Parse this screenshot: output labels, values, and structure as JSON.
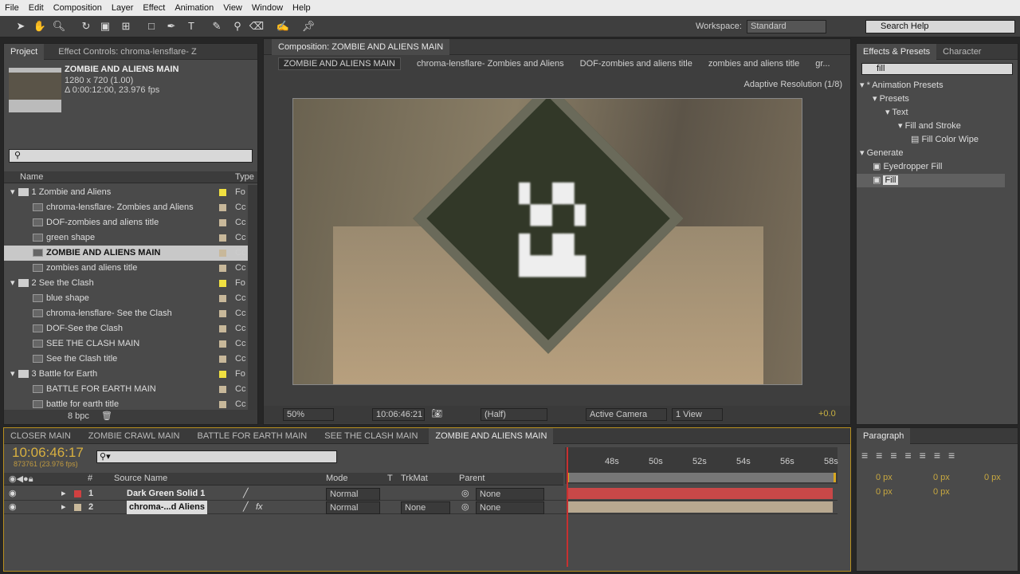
{
  "menu": [
    "File",
    "Edit",
    "Composition",
    "Layer",
    "Effect",
    "Animation",
    "View",
    "Window",
    "Help"
  ],
  "toolbar": {
    "workspace_label": "Workspace:",
    "workspace": "Standard",
    "search_placeholder": "Search Help"
  },
  "project": {
    "tab": "Project",
    "effect_controls_tab": "Effect Controls: chroma-lensflare- Z",
    "comp_name": "ZOMBIE AND ALIENS MAIN",
    "dims": "1280 x 720 (1.00)",
    "duration": "Δ 0:00:12:00, 23.976 fps",
    "col_name": "Name",
    "col_type": "Type",
    "bpc": "8 bpc",
    "items": [
      {
        "label": "1 Zombie and Aliens",
        "folder": true,
        "color": "#f0e040",
        "type": "Fo"
      },
      {
        "label": "chroma-lensflare- Zombies and Aliens",
        "color": "#c8b89a",
        "type": "Cc"
      },
      {
        "label": "DOF-zombies and aliens title",
        "color": "#c8b89a",
        "type": "Cc"
      },
      {
        "label": "green shape",
        "color": "#c8b89a",
        "type": "Cc"
      },
      {
        "label": "ZOMBIE AND ALIENS MAIN",
        "color": "#c8b89a",
        "type": "Cc",
        "selected": true
      },
      {
        "label": "zombies and aliens title",
        "color": "#c8b89a",
        "type": "Cc"
      },
      {
        "label": "2 See the Clash",
        "folder": true,
        "color": "#f0e040",
        "type": "Fo"
      },
      {
        "label": "blue shape",
        "color": "#c8b89a",
        "type": "Cc"
      },
      {
        "label": "chroma-lensflare- See the Clash",
        "color": "#c8b89a",
        "type": "Cc"
      },
      {
        "label": "DOF-See the Clash",
        "color": "#c8b89a",
        "type": "Cc"
      },
      {
        "label": "SEE THE CLASH MAIN",
        "color": "#c8b89a",
        "type": "Cc"
      },
      {
        "label": "See the Clash title",
        "color": "#c8b89a",
        "type": "Cc"
      },
      {
        "label": "3 Battle for Earth",
        "folder": true,
        "color": "#f0e040",
        "type": "Fo"
      },
      {
        "label": "BATTLE FOR EARTH MAIN",
        "color": "#c8b89a",
        "type": "Cc"
      },
      {
        "label": "battle for earth title",
        "color": "#c8b89a",
        "type": "Cc"
      }
    ]
  },
  "comp": {
    "tab": "Composition: ZOMBIE AND ALIENS MAIN",
    "breadcrumbs": [
      "ZOMBIE AND ALIENS MAIN",
      "chroma-lensflare- Zombies and Aliens",
      "DOF-zombies and aliens title",
      "zombies and aliens title",
      "gr..."
    ],
    "resolution_note": "Adaptive Resolution (1/8)",
    "zoom": "50%",
    "timecode": "10:06:46:21",
    "quality": "(Half)",
    "camera": "Active Camera",
    "views": "1 View",
    "exposure": "+0.0"
  },
  "effects": {
    "tab": "Effects & Presets",
    "character_tab": "Character",
    "search": "fill",
    "tree": [
      {
        "label": "* Animation Presets",
        "indent": 0,
        "kind": "tri"
      },
      {
        "label": "Presets",
        "indent": 1,
        "kind": "folder"
      },
      {
        "label": "Text",
        "indent": 2,
        "kind": "folder"
      },
      {
        "label": "Fill and Stroke",
        "indent": 3,
        "kind": "folder"
      },
      {
        "label": "Fill Color Wipe",
        "indent": 4,
        "kind": "preset"
      },
      {
        "label": "Generate",
        "indent": 0,
        "kind": "tri"
      },
      {
        "label": "Eyedropper Fill",
        "indent": 1,
        "kind": "fx"
      },
      {
        "label": "Fill",
        "indent": 1,
        "kind": "fx",
        "selected": true
      }
    ]
  },
  "timeline": {
    "tabs": [
      "CLOSER MAIN",
      "ZOMBIE CRAWL MAIN",
      "BATTLE FOR EARTH MAIN",
      "SEE THE CLASH MAIN",
      "ZOMBIE AND ALIENS MAIN"
    ],
    "active_tab": 4,
    "timecode": "10:06:46:17",
    "frames": "873761 (23.976 fps)",
    "col_source": "Source Name",
    "col_mode": "Mode",
    "col_t": "T",
    "col_trkmat": "TrkMat",
    "col_parent": "Parent",
    "ruler": [
      "48s",
      "50s",
      "52s",
      "54s",
      "56s",
      "58s"
    ],
    "layers": [
      {
        "num": "1",
        "name": "Dark Green Solid 1",
        "label_color": "#d04040",
        "mode": "Normal",
        "trkmat": "",
        "parent": "None",
        "fx": false,
        "bar": "#c84848"
      },
      {
        "num": "2",
        "name": "chroma-...d Aliens",
        "label_color": "#c8b89a",
        "mode": "Normal",
        "trkmat": "None",
        "parent": "None",
        "fx": true,
        "bar": "#b8a890"
      }
    ]
  },
  "paragraph": {
    "tab": "Paragraph",
    "values": [
      "0 px",
      "0 px",
      "0 px",
      "0 px",
      "0 px"
    ]
  }
}
